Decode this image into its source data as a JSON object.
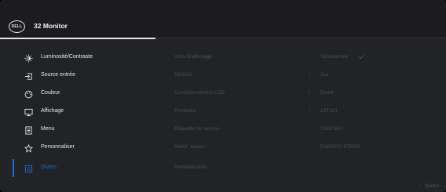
{
  "header": {
    "logo_text": "DELL",
    "title": "32 Monitor"
  },
  "menu": [
    {
      "label": "Luminosité/Contraste",
      "icon": "brightness-icon"
    },
    {
      "label": "Source entrée",
      "icon": "input-source-icon"
    },
    {
      "label": "Couleur",
      "icon": "color-palette-icon"
    },
    {
      "label": "Affichage",
      "icon": "display-icon"
    },
    {
      "label": "Menu",
      "icon": "menu-icon"
    },
    {
      "label": "Personnaliser",
      "icon": "star-icon"
    },
    {
      "label": "Divers",
      "icon": "others-icon"
    }
  ],
  "active_menu_index": 6,
  "submenu": [
    {
      "key": "Infos D'affichage",
      "value": "Sélectionner",
      "has_arrow": false,
      "has_check": true
    },
    {
      "key": "DDC/CI",
      "value": "Sur",
      "has_arrow": true
    },
    {
      "key": "Conditionnement LCD",
      "value": "Eteint",
      "has_arrow": true
    },
    {
      "key": "Firmware",
      "value": "13T101",
      "has_arrow": true
    },
    {
      "key": "Étiquette de service",
      "value": "CN073K0",
      "has_arrow": true
    },
    {
      "key": "Réinit. autres",
      "value": "ENERGY STAR®",
      "has_arrow": false
    },
    {
      "key": "Réinitialisation",
      "value": "",
      "has_arrow": false
    }
  ],
  "footer": {
    "exit_label": "Quitter"
  },
  "colors": {
    "accent": "#1a6fd0",
    "dim_text": "#4d4e52",
    "background": "#222326"
  }
}
